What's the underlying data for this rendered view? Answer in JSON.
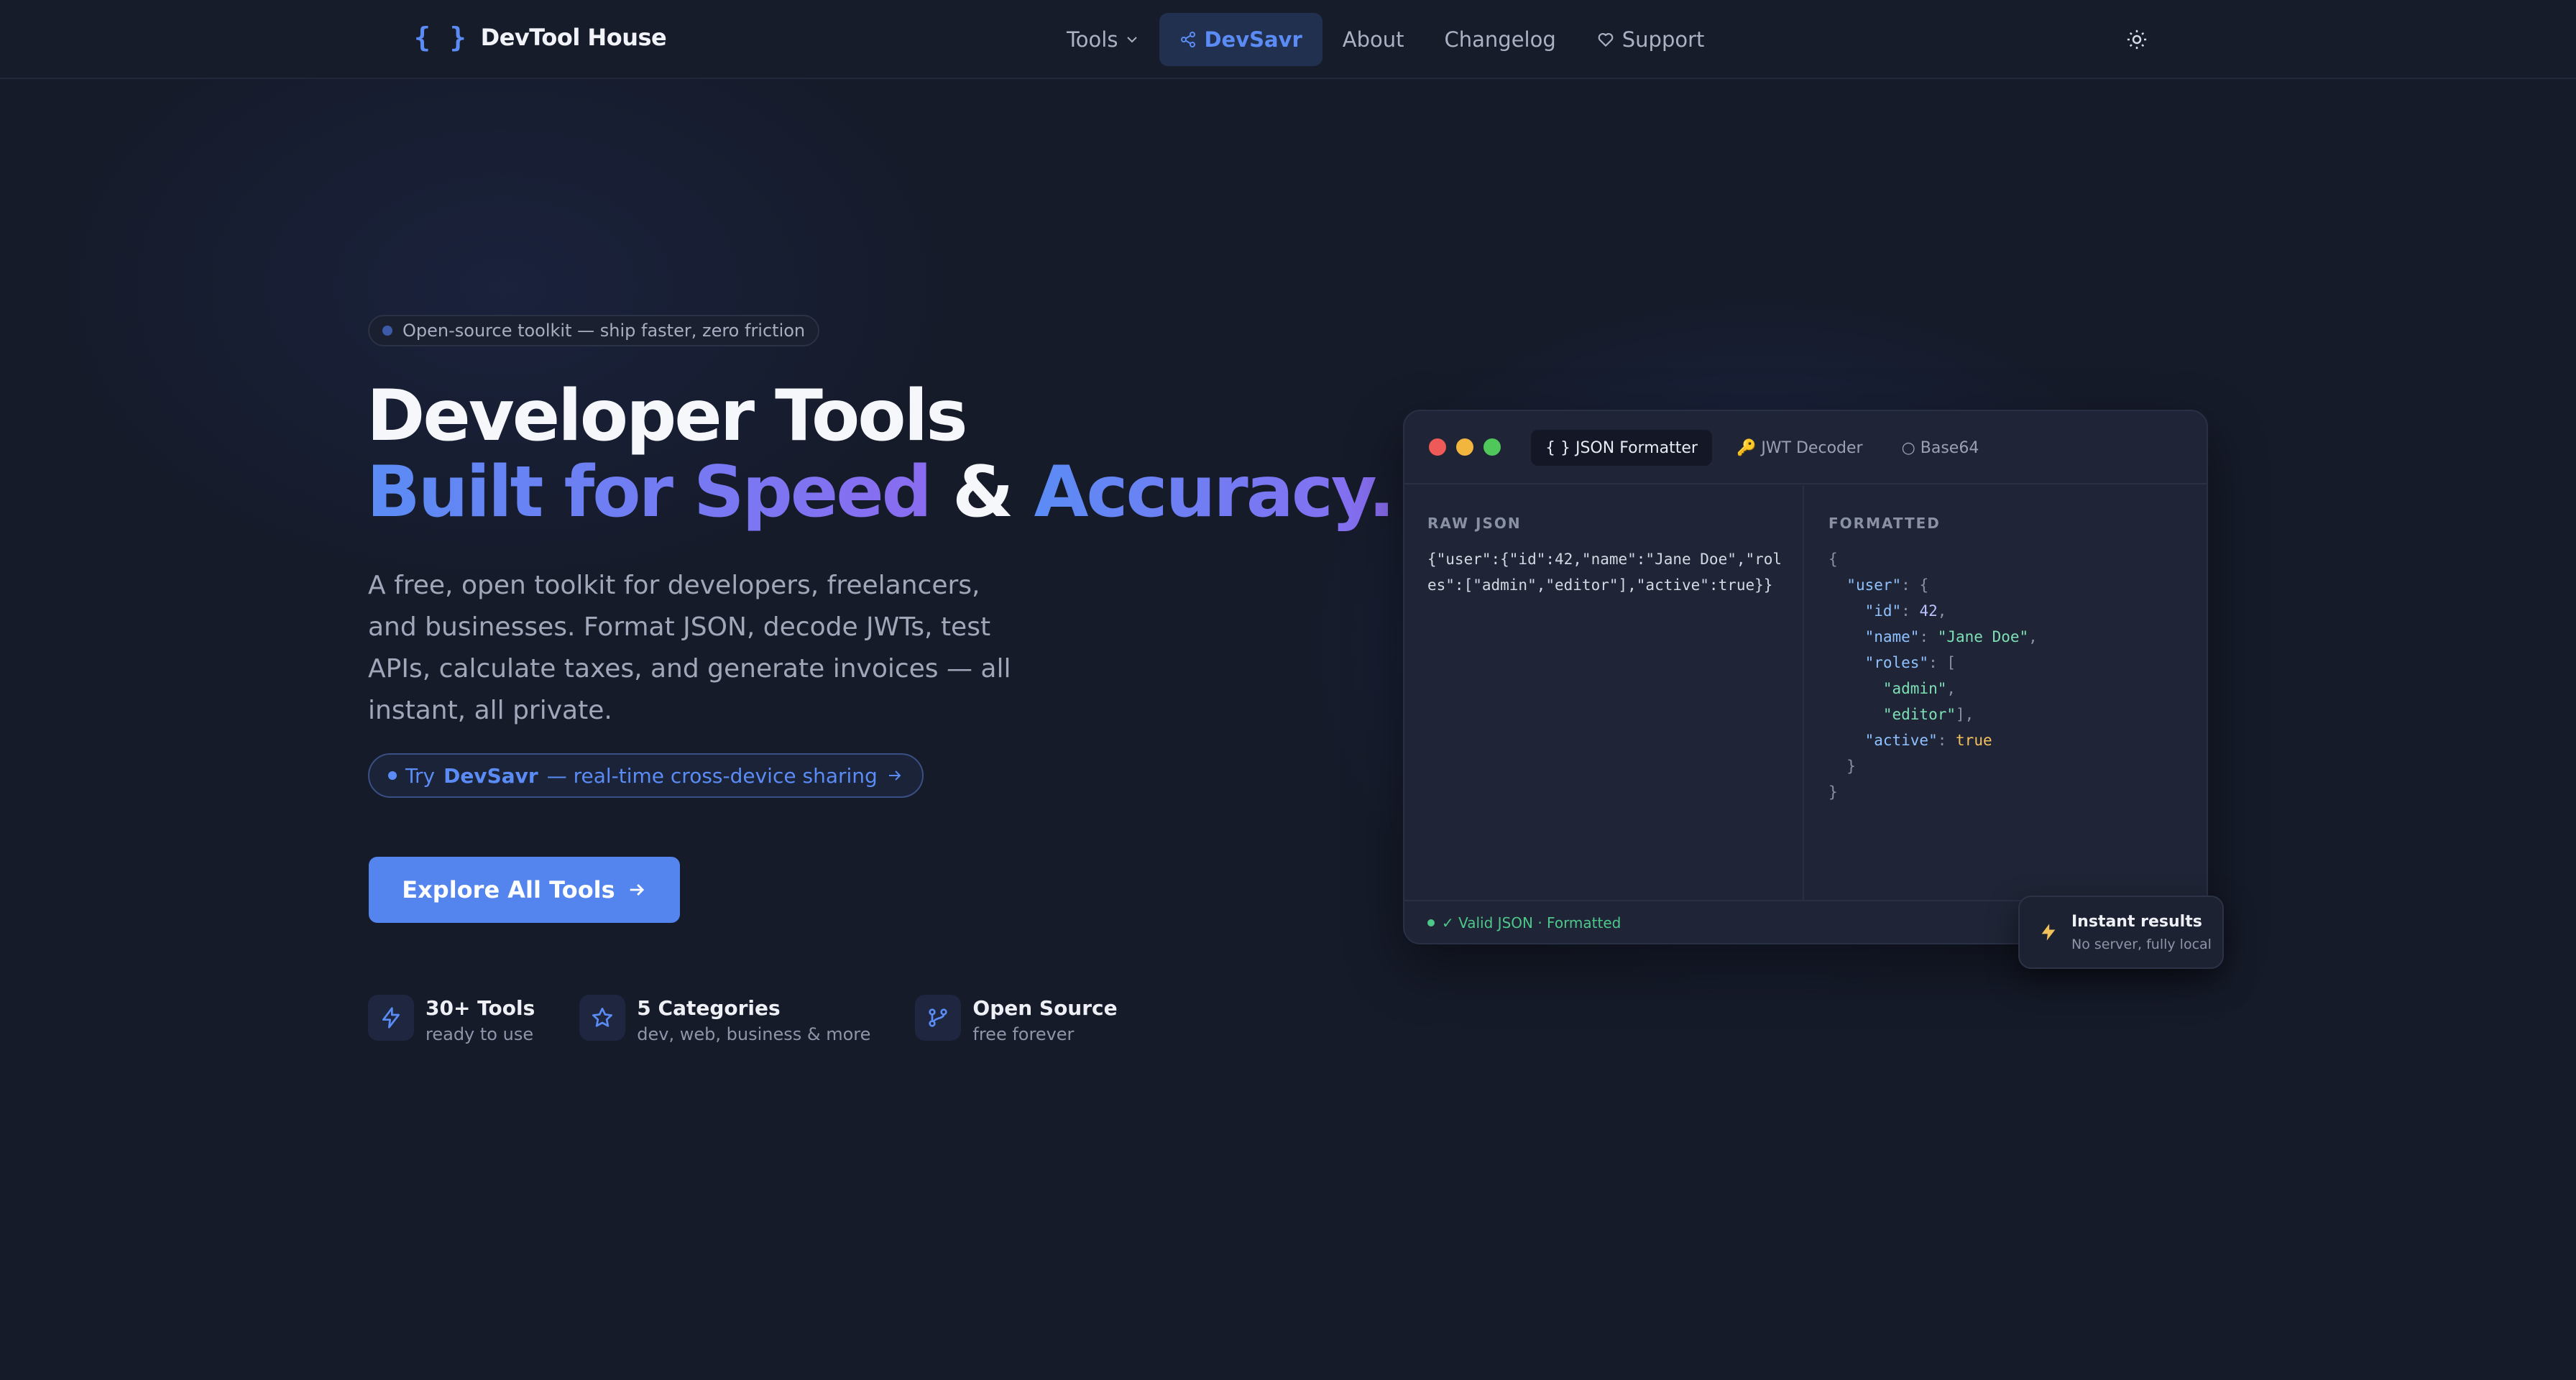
{
  "nav": {
    "brand_icon": "{ }",
    "brand_name": "DevTool House",
    "links": [
      {
        "label": "Tools",
        "icon": "chevron-down-icon"
      },
      {
        "label": "DevSavr",
        "icon": "share-icon",
        "active": true
      },
      {
        "label": "About"
      },
      {
        "label": "Changelog"
      },
      {
        "label": "Support",
        "icon": "heart-icon"
      }
    ],
    "theme_icon": "sun-icon"
  },
  "hero": {
    "badge": "Open-source toolkit — ship faster, zero friction",
    "title_line1": "Developer Tools",
    "title_line2_a": "Built for Speed",
    "title_line2_amp": "&",
    "title_line2_b": "Accuracy.",
    "lead": "A free, open toolkit for developers, freelancers, and businesses. Format JSON, decode JWTs, test APIs, calculate taxes, and generate invoices — all instant, all private.",
    "try_prefix": "Try",
    "try_brand": "DevSavr",
    "try_suffix": "— real-time cross-device sharing",
    "cta_label": "Explore All Tools"
  },
  "stats": [
    {
      "title": "30+ Tools",
      "sub": "ready to use",
      "icon": "lightning-icon"
    },
    {
      "title": "5 Categories",
      "sub": "dev, web, business & more",
      "icon": "star-icon"
    },
    {
      "title": "Open Source",
      "sub": "free forever",
      "icon": "git-branch-icon"
    }
  ],
  "editor": {
    "tabs": [
      {
        "label": "{ } JSON Formatter",
        "active": true
      },
      {
        "label": "🔑 JWT Decoder"
      },
      {
        "label": "○ Base64"
      }
    ],
    "raw_label": "RAW JSON",
    "raw_text": "{\"user\":{\"id\":42,\"name\":\"Jane Doe\",\"roles\":[\"admin\",\"editor\"],\"active\":true}}",
    "formatted_label": "FORMATTED",
    "status": "✓ Valid JSON · Formatted"
  },
  "toast": {
    "title": "Instant results",
    "sub": "No server, fully local",
    "icon": "lightning-icon"
  },
  "colors": {
    "accent": "#5b8cf5",
    "accent_purple": "#8a6cf0",
    "background": "#161b2a",
    "success": "#4ec78a"
  }
}
